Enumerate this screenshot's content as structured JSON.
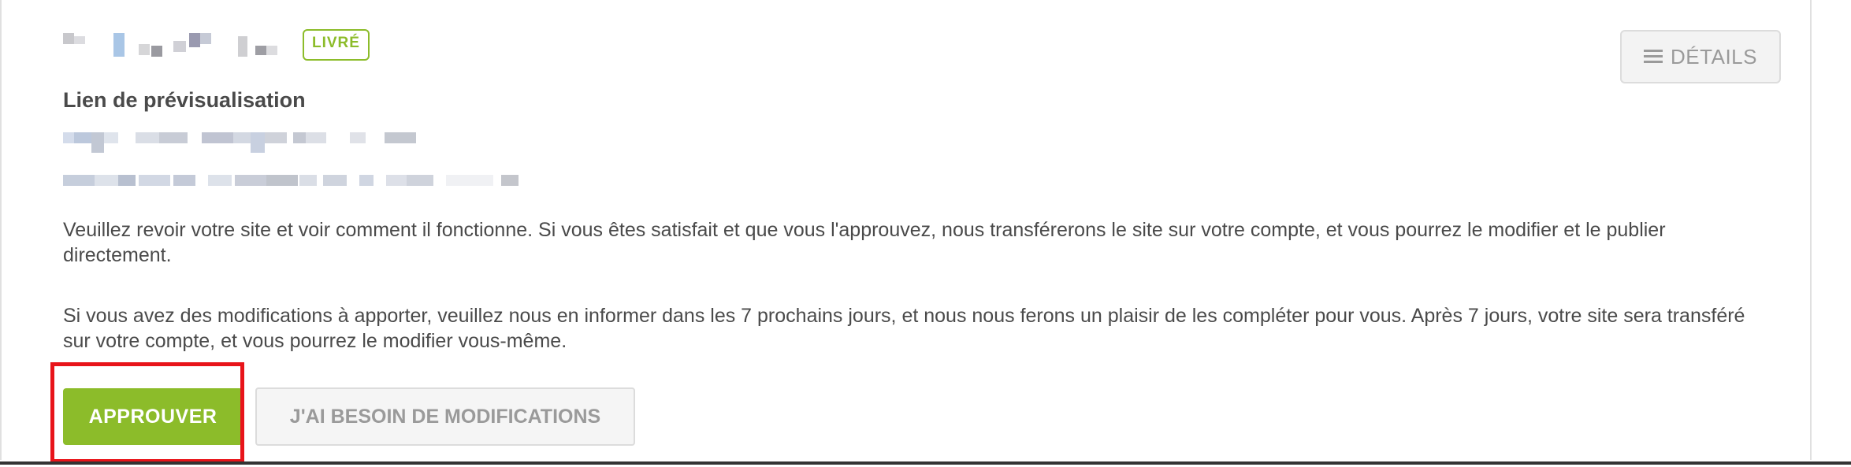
{
  "order": {
    "status_badge": "LIVRÉ"
  },
  "toolbar": {
    "details_label": "DÉTAILS",
    "details_icon": "list-icon"
  },
  "preview": {
    "title": "Lien de prévisualisation"
  },
  "messages": {
    "review_text": "Veuillez revoir votre site et voir comment il fonctionne. Si vous êtes satisfait et que vous l'approuvez, nous transférerons le site sur votre compte, et vous pourrez le modifier et le publier directement.",
    "modifications_text": "Si vous avez des modifications à apporter, veuillez nous en informer dans les 7 prochains jours, et nous nous ferons un plaisir de les compléter pour vous. Après 7 jours, votre site sera transféré sur votre compte, et vous pourrez le modifier vous-même."
  },
  "actions": {
    "approve_label": "APPROUVER",
    "request_changes_label": "J'AI BESOIN DE MODIFICATIONS"
  },
  "colors": {
    "accent_green": "#8cbc2a",
    "highlight_red": "#e8141a"
  }
}
